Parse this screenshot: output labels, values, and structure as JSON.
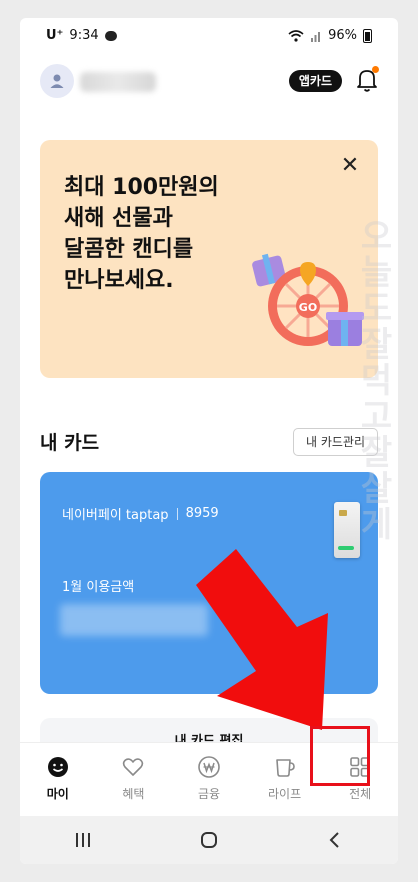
{
  "status_bar": {
    "carrier": "U⁺",
    "time": "9:34",
    "battery": "96%"
  },
  "header": {
    "app_card_label": "앱카드"
  },
  "promo": {
    "text": "최대 100만원의\n새해 선물과\n달콤한 캔디를\n만나보세요.",
    "badge_text": "GO"
  },
  "my_cards": {
    "title": "내 카드",
    "manage_label": "내 카드관리",
    "card": {
      "name": "네이버페이 taptap",
      "last_digits": "8959",
      "usage_label": "1월 이용금액"
    },
    "edit_label": "내 카드 편집"
  },
  "bottom_nav": {
    "items": [
      {
        "label": "마이",
        "icon": "smile-icon",
        "active": true
      },
      {
        "label": "혜택",
        "icon": "heart-icon",
        "active": false
      },
      {
        "label": "금융",
        "icon": "won-icon",
        "active": false
      },
      {
        "label": "라이프",
        "icon": "cup-icon",
        "active": false
      },
      {
        "label": "전체",
        "icon": "grid-icon",
        "active": false
      }
    ]
  },
  "watermark": "오늘도잘먹고잘살게",
  "colors": {
    "card_blue": "#4d9bec",
    "promo_bg": "#fde3c1",
    "annotation_red": "#e8101a",
    "notification_dot": "#ff7a00"
  }
}
